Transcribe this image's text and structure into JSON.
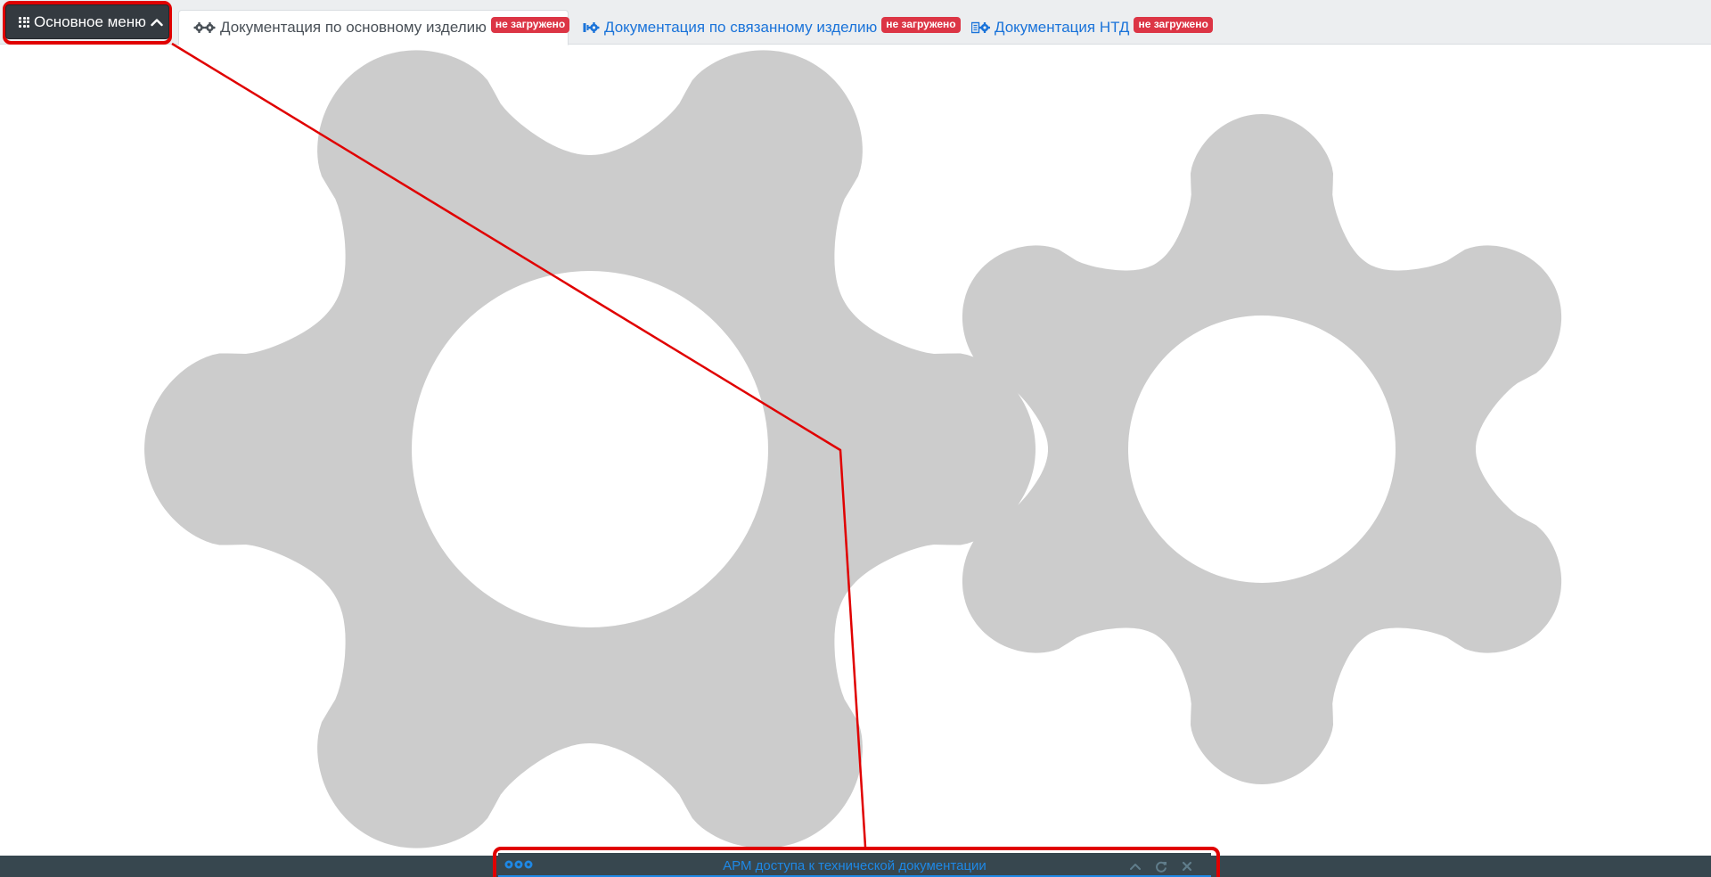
{
  "menu": {
    "label": "Основное меню",
    "grid_icon": "apps-grid-icon",
    "chevron_icon": "chevron-up-icon"
  },
  "tabs": [
    {
      "label": "Документация по основному изделию",
      "badge": "не загружено",
      "icon": "gears-icon",
      "active": true
    },
    {
      "label": "Документация по связанному изделию",
      "badge": "не загружено",
      "icon": "linked-gear-icon",
      "active": false
    },
    {
      "label": "Документация НТД",
      "badge": "не загружено",
      "icon": "book-gear-icon",
      "active": false
    }
  ],
  "bottom_panel": {
    "title": "АРМ доступа к технической документации",
    "icons": [
      "gears-icon"
    ],
    "controls": [
      "chevron-up-icon",
      "refresh-icon",
      "close-icon"
    ]
  },
  "colors": {
    "menu_button_bg": "#343a40",
    "badge_bg": "#dc3545",
    "link_blue": "#1a73d9",
    "gear_fill": "#cccccc",
    "bottom_bar_bg": "#37474f",
    "annotation_red": "#e00000"
  }
}
